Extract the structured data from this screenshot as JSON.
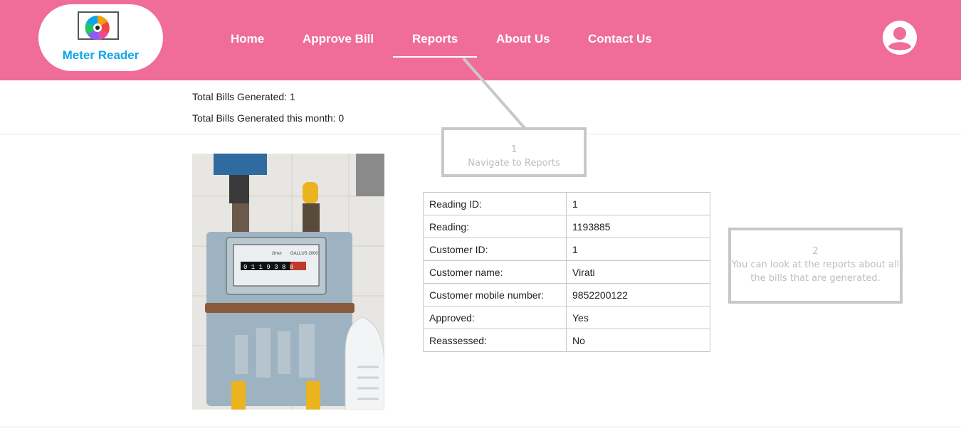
{
  "brand": {
    "name": "Meter Reader"
  },
  "nav": {
    "items": [
      {
        "label": "Home"
      },
      {
        "label": "Approve Bill"
      },
      {
        "label": "Reports"
      },
      {
        "label": "About Us"
      },
      {
        "label": "Contact Us"
      }
    ],
    "active": "Reports"
  },
  "stats": {
    "total_bills": "Total Bills Generated: 1",
    "total_bills_month": "Total Bills Generated this month: 0"
  },
  "reading": {
    "rows": [
      {
        "label": "Reading ID:",
        "value": "1"
      },
      {
        "label": "Reading:",
        "value": "1193885"
      },
      {
        "label": "Customer ID:",
        "value": "1"
      },
      {
        "label": "Customer name:",
        "value": "Virati"
      },
      {
        "label": "Customer mobile number:",
        "value": "9852200122"
      },
      {
        "label": "Approved:",
        "value": "Yes"
      },
      {
        "label": "Reassessed:",
        "value": "No"
      }
    ]
  },
  "meter_display": {
    "brand": "Itron",
    "model": "GALLUS 2000",
    "counter": "0 1 1 9 3 8 8"
  },
  "callouts": [
    {
      "number": "1",
      "text": "Navigate to Reports"
    },
    {
      "number": "2",
      "text": "You can look at the reports about all the bills that are generated."
    }
  ],
  "colors": {
    "header": "#f06c99",
    "brand_text": "#0ea5e9",
    "callout_border": "#c8c8c8"
  }
}
